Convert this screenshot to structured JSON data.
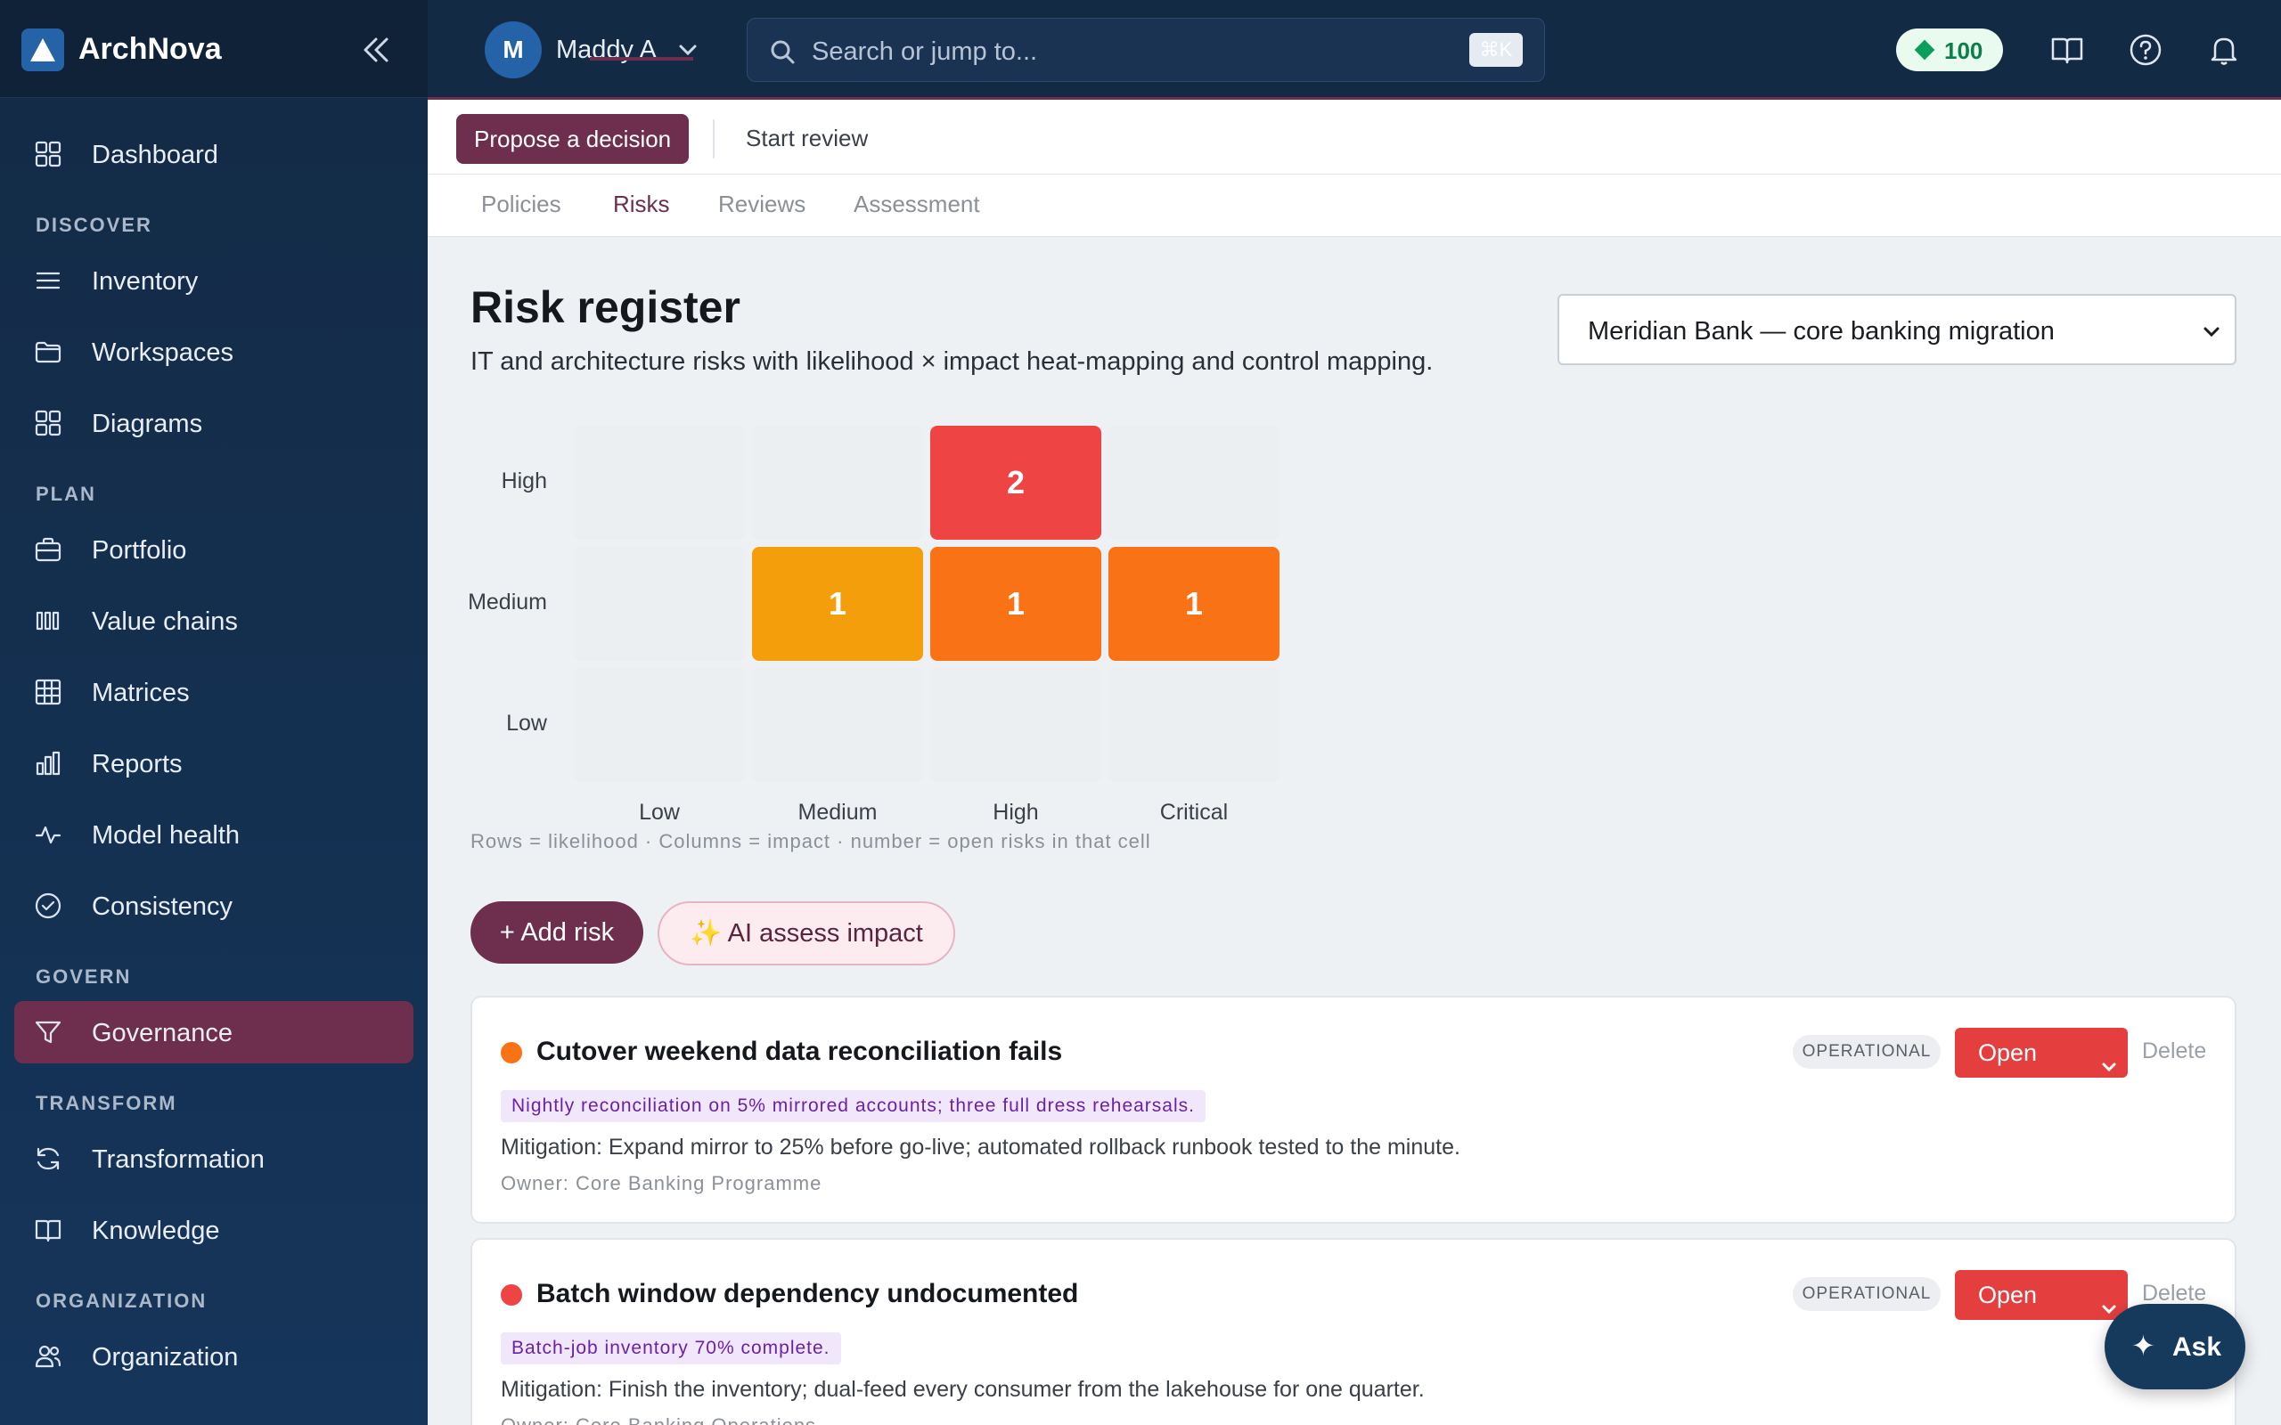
{
  "brand": {
    "name": "ArchNova"
  },
  "sidebar": {
    "items": [
      {
        "type": "item",
        "label": "Dashboard",
        "icon": "grid-icon"
      },
      {
        "type": "section",
        "label": "DISCOVER"
      },
      {
        "type": "item",
        "label": "Inventory",
        "icon": "list-icon"
      },
      {
        "type": "item",
        "label": "Workspaces",
        "icon": "folder-icon"
      },
      {
        "type": "item",
        "label": "Diagrams",
        "icon": "grid-icon"
      },
      {
        "type": "section",
        "label": "PLAN"
      },
      {
        "type": "item",
        "label": "Portfolio",
        "icon": "briefcase-icon"
      },
      {
        "type": "item",
        "label": "Value chains",
        "icon": "columns-icon"
      },
      {
        "type": "item",
        "label": "Matrices",
        "icon": "table-icon"
      },
      {
        "type": "item",
        "label": "Reports",
        "icon": "bar-chart-icon"
      },
      {
        "type": "item",
        "label": "Model health",
        "icon": "pulse-icon"
      },
      {
        "type": "item",
        "label": "Consistency",
        "icon": "check-circle-icon"
      },
      {
        "type": "section",
        "label": "GOVERN"
      },
      {
        "type": "item",
        "label": "Governance",
        "icon": "filter-icon",
        "active": true
      },
      {
        "type": "section",
        "label": "TRANSFORM"
      },
      {
        "type": "item",
        "label": "Transformation",
        "icon": "refresh-icon"
      },
      {
        "type": "item",
        "label": "Knowledge",
        "icon": "book-icon"
      },
      {
        "type": "section",
        "label": "ORGANIZATION"
      },
      {
        "type": "item",
        "label": "Organization",
        "icon": "users-icon"
      }
    ]
  },
  "topbar": {
    "avatar_initial": "M",
    "user_name": "Maddy A",
    "search_placeholder": "Search or jump to...",
    "search_shortcut": "⌘K",
    "credits": "100"
  },
  "actions": {
    "propose": "Propose a decision",
    "review": "Start review"
  },
  "tabs": [
    "Policies",
    "Risks",
    "Reviews",
    "Assessment"
  ],
  "page": {
    "title": "Risk register",
    "subtitle": "IT and architecture risks with likelihood × impact heat-mapping and control mapping.",
    "project": "Meridian Bank — core banking migration"
  },
  "heatmap": {
    "rows": [
      "High",
      "Medium",
      "Low"
    ],
    "cols": [
      "Low",
      "Medium",
      "High",
      "Critical"
    ],
    "cells": [
      {
        "row": 0,
        "col": 2,
        "count": "2",
        "color": "#ef4444"
      },
      {
        "row": 1,
        "col": 1,
        "count": "1",
        "color": "#f59e0b"
      },
      {
        "row": 1,
        "col": 2,
        "count": "1",
        "color": "#f97316"
      },
      {
        "row": 1,
        "col": 3,
        "count": "1",
        "color": "#f97316"
      }
    ],
    "caption": "Rows = likelihood · Columns = impact · number = open risks in that cell"
  },
  "buttons": {
    "add_risk": "+ Add risk",
    "ai_assess": "✨ AI assess impact"
  },
  "risks": [
    {
      "title": "Cutover weekend data reconciliation fails",
      "dot_color": "#f97316",
      "category": "OPERATIONAL",
      "status": "Open",
      "delete": "Delete",
      "signal": "Nightly reconciliation on 5% mirrored accounts; three full dress rehearsals.",
      "mitigation": "Mitigation: Expand mirror to 25% before go-live; automated rollback runbook tested to the minute.",
      "owner": "Owner: Core Banking Programme"
    },
    {
      "title": "Batch window dependency undocumented",
      "dot_color": "#ef4444",
      "category": "OPERATIONAL",
      "status": "Open",
      "delete": "Delete",
      "signal": "Batch-job inventory 70% complete.",
      "mitigation": "Mitigation: Finish the inventory; dual-feed every consumer from the lakehouse for one quarter.",
      "owner": "Owner: Core Banking Operations"
    }
  ],
  "ask": {
    "label": "Ask"
  }
}
